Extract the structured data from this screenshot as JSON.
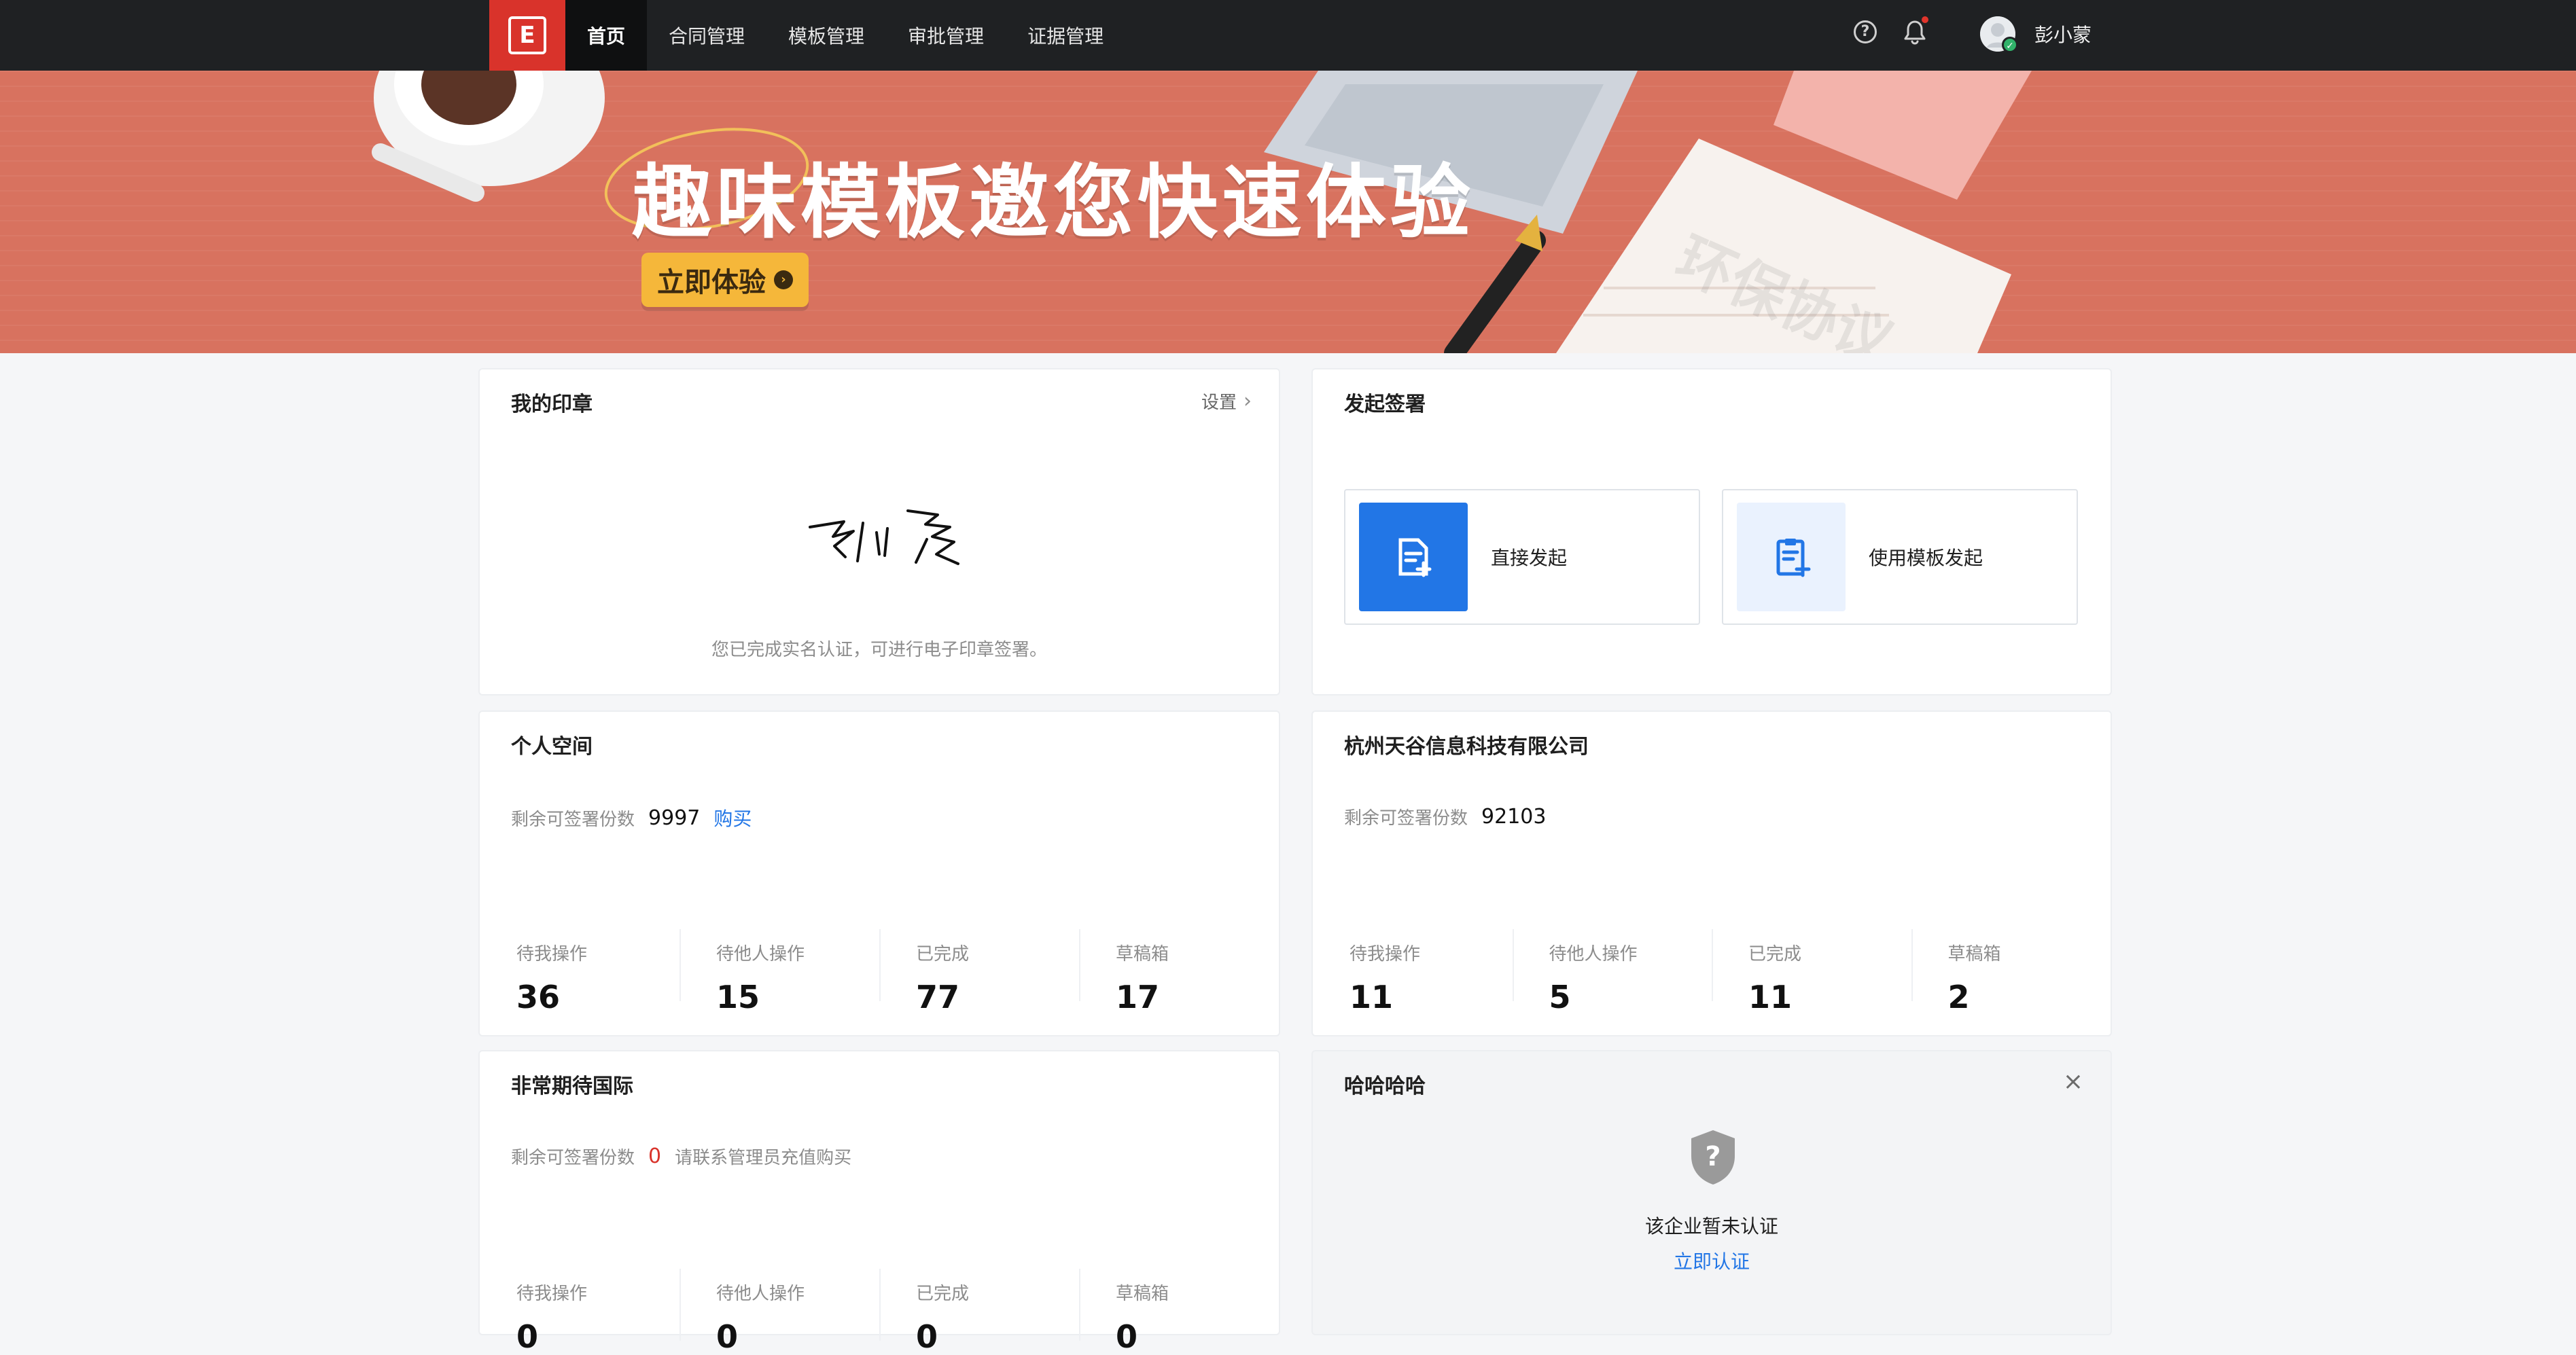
{
  "header": {
    "nav": [
      "首页",
      "合同管理",
      "模板管理",
      "审批管理",
      "证据管理"
    ],
    "active_index": 0,
    "username": "彭小蒙",
    "icons": [
      "help-icon",
      "bell-icon",
      "avatar"
    ]
  },
  "banner": {
    "title": "趣味模板邀您快速体验",
    "cta_label": "立即体验",
    "illustration_text": "环保协议"
  },
  "seal_card": {
    "title": "我的印章",
    "settings_label": "设置",
    "note": "您已完成实名认证，可进行电子印章签署。"
  },
  "start_card": {
    "title": "发起签署",
    "options": [
      {
        "label": "直接发起"
      },
      {
        "label": "使用模板发起"
      }
    ]
  },
  "personal_card": {
    "title": "个人空间",
    "remaining_label": "剩余可签署份数",
    "remaining_value": "9997",
    "buy_label": "购买",
    "stats": [
      {
        "label": "待我操作",
        "value": "36"
      },
      {
        "label": "待他人操作",
        "value": "15"
      },
      {
        "label": "已完成",
        "value": "77"
      },
      {
        "label": "草稿箱",
        "value": "17"
      }
    ]
  },
  "company_card": {
    "title": "杭州天谷信息科技有限公司",
    "remaining_label": "剩余可签署份数",
    "remaining_value": "92103",
    "stats": [
      {
        "label": "待我操作",
        "value": "11"
      },
      {
        "label": "待他人操作",
        "value": "5"
      },
      {
        "label": "已完成",
        "value": "11"
      },
      {
        "label": "草稿箱",
        "value": "2"
      }
    ]
  },
  "intl_card": {
    "title": "非常期待国际",
    "remaining_label": "剩余可签署份数",
    "remaining_value": "0",
    "contact_note": "请联系管理员充值购买",
    "stats": [
      {
        "label": "待我操作",
        "value": "0"
      },
      {
        "label": "待他人操作",
        "value": "0"
      },
      {
        "label": "已完成",
        "value": "0"
      },
      {
        "label": "草稿箱",
        "value": "0"
      }
    ]
  },
  "haha_card": {
    "title": "哈哈哈哈",
    "status": "该企业暂未认证",
    "verify_label": "立即认证"
  }
}
